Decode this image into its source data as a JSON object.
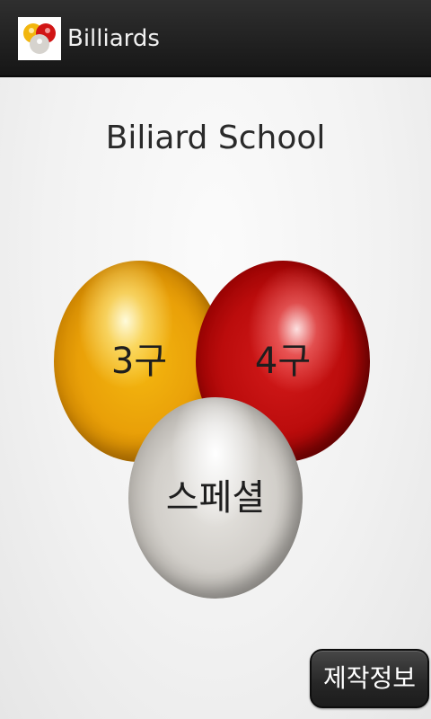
{
  "titlebar": {
    "app_name": "Billiards",
    "icon": "billiard-balls-icon"
  },
  "main": {
    "title": "Biliard School",
    "balls": [
      {
        "label": "3구",
        "color": "#e9a008"
      },
      {
        "label": "4구",
        "color": "#bb0c0c"
      },
      {
        "label": "스페셜",
        "color": "#d2cfca"
      }
    ],
    "info_button_label": "제작정보"
  },
  "colors": {
    "titlebar_bg": "#1f1f1f",
    "background": "#f2f2f2",
    "text": "#2a2a2a"
  }
}
